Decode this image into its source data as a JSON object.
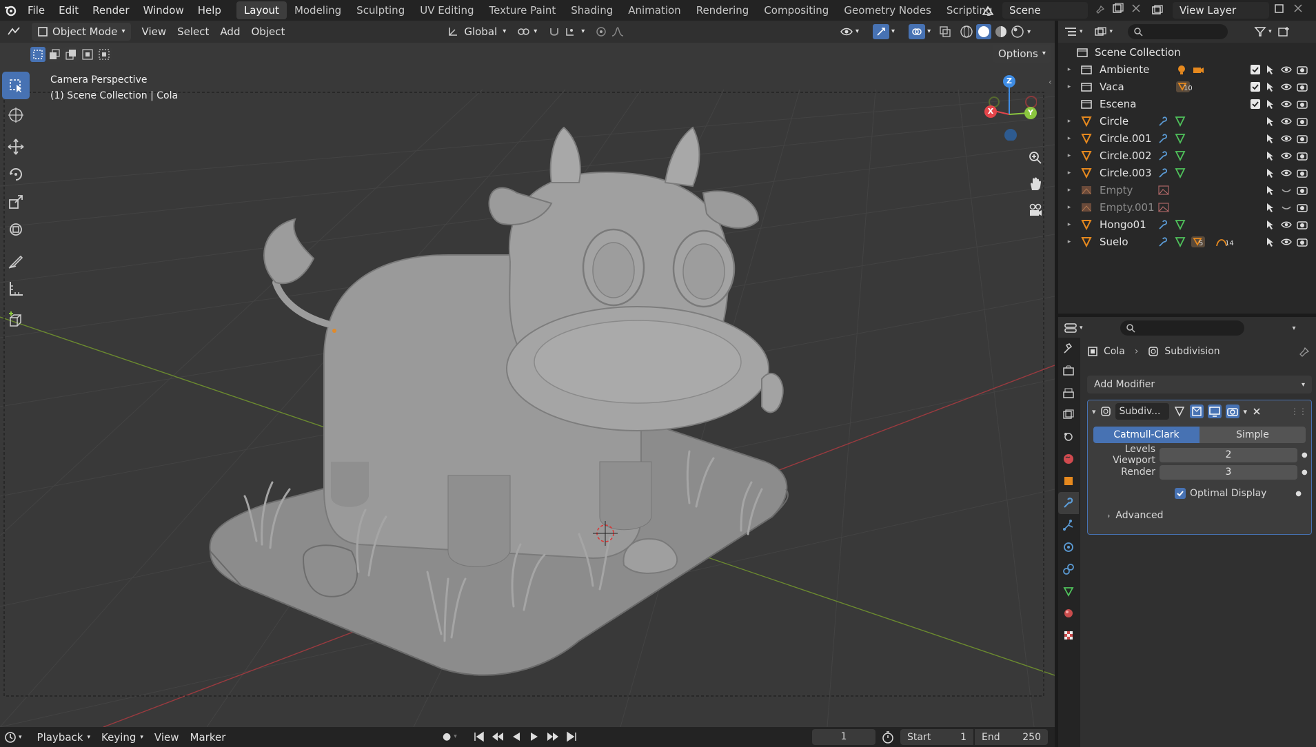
{
  "topbar": {
    "menus": [
      "File",
      "Edit",
      "Render",
      "Window",
      "Help"
    ],
    "workspaces": [
      "Layout",
      "Modeling",
      "Sculpting",
      "UV Editing",
      "Texture Paint",
      "Shading",
      "Animation",
      "Rendering",
      "Compositing",
      "Geometry Nodes",
      "Scripting"
    ],
    "active_workspace": "Layout",
    "add_tab": "+",
    "scene": "Scene",
    "view_layer": "View Layer"
  },
  "viewport_header": {
    "mode": "Object Mode",
    "menus": [
      "View",
      "Select",
      "Add",
      "Object"
    ],
    "orientation": "Global",
    "options": "Options"
  },
  "viewport": {
    "camera_label": "Camera Perspective",
    "collection_label": "(1) Scene Collection | Cola",
    "gizmo_axes": {
      "x": "X",
      "y": "Y",
      "z": "Z"
    },
    "colors": {
      "x_axis": "#e4454a",
      "y_axis": "#8bc63f",
      "z_axis": "#3f8de5"
    }
  },
  "outliner": {
    "root": "Scene Collection",
    "items": [
      {
        "name": "Ambiente",
        "kind": "collection"
      },
      {
        "name": "Vaca",
        "kind": "collection",
        "badge": "10"
      },
      {
        "name": "Escena",
        "kind": "collection"
      },
      {
        "name": "Circle",
        "kind": "mesh"
      },
      {
        "name": "Circle.001",
        "kind": "mesh"
      },
      {
        "name": "Circle.002",
        "kind": "mesh"
      },
      {
        "name": "Circle.003",
        "kind": "mesh"
      },
      {
        "name": "Empty",
        "kind": "empty"
      },
      {
        "name": "Empty.001",
        "kind": "empty"
      },
      {
        "name": "Hongo01",
        "kind": "mesh"
      },
      {
        "name": "Suelo",
        "kind": "mesh",
        "badge": "5",
        "badge2": "14"
      }
    ]
  },
  "properties": {
    "breadcrumb_object": "Cola",
    "breadcrumb_modifier": "Subdivision",
    "add_modifier": "Add Modifier",
    "modifier_name": "Subdiv...",
    "algo_options": [
      "Catmull-Clark",
      "Simple"
    ],
    "algo_selected": "Catmull-Clark",
    "levels_viewport_label": "Levels Viewport",
    "levels_viewport": "2",
    "render_label": "Render",
    "render_levels": "3",
    "optimal_display": "Optimal Display",
    "advanced": "Advanced"
  },
  "timeline": {
    "menus": [
      "Playback",
      "Keying",
      "View",
      "Marker"
    ],
    "current_frame": "1",
    "start_label": "Start",
    "start": "1",
    "end_label": "End",
    "end": "250"
  }
}
